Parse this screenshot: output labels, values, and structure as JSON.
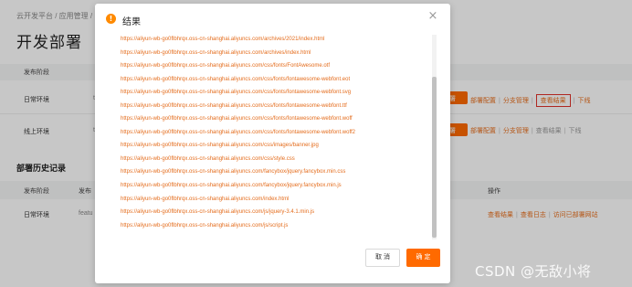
{
  "background": {
    "breadcrumb": "云开发平台 / 应用管理 /",
    "page_title": "开发部署",
    "deploy_header": "发布阶段",
    "rows": [
      {
        "label": "日常环境",
        "frag": "t"
      },
      {
        "label": "线上环境",
        "frag": "t"
      }
    ],
    "deploy_button": "署",
    "actions": {
      "config": "部署配置",
      "branch": "分支管理",
      "view_result": "查看结果",
      "offline": "下线"
    },
    "history_title": "部署历史记录",
    "history_headers": {
      "stage": "发布阶段",
      "version": "发布",
      "operation": "操作"
    },
    "history_row": {
      "stage": "日常环境",
      "version": "featu",
      "view_result": "查看结果",
      "view_log": "查看日志",
      "visit_site": "访问已部署网站"
    }
  },
  "modal": {
    "title": "结果",
    "links": [
      "https://aliyun-wb-go0flbhrqx.oss-cn-shanghai.aliyuncs.com/archives/2021/index.html",
      "https://aliyun-wb-go0flbhrqx.oss-cn-shanghai.aliyuncs.com/archives/index.html",
      "https://aliyun-wb-go0flbhrqx.oss-cn-shanghai.aliyuncs.com/css/fonts/FontAwesome.otf",
      "https://aliyun-wb-go0flbhrqx.oss-cn-shanghai.aliyuncs.com/css/fonts/fontawesome-webfont.eot",
      "https://aliyun-wb-go0flbhrqx.oss-cn-shanghai.aliyuncs.com/css/fonts/fontawesome-webfont.svg",
      "https://aliyun-wb-go0flbhrqx.oss-cn-shanghai.aliyuncs.com/css/fonts/fontawesome-webfont.ttf",
      "https://aliyun-wb-go0flbhrqx.oss-cn-shanghai.aliyuncs.com/css/fonts/fontawesome-webfont.woff",
      "https://aliyun-wb-go0flbhrqx.oss-cn-shanghai.aliyuncs.com/css/fonts/fontawesome-webfont.woff2",
      "https://aliyun-wb-go0flbhrqx.oss-cn-shanghai.aliyuncs.com/css/images/banner.jpg",
      "https://aliyun-wb-go0flbhrqx.oss-cn-shanghai.aliyuncs.com/css/style.css",
      "https://aliyun-wb-go0flbhrqx.oss-cn-shanghai.aliyuncs.com/fancybox/jquery.fancybox.min.css",
      "https://aliyun-wb-go0flbhrqx.oss-cn-shanghai.aliyuncs.com/fancybox/jquery.fancybox.min.js",
      "https://aliyun-wb-go0flbhrqx.oss-cn-shanghai.aliyuncs.com/index.html",
      "https://aliyun-wb-go0flbhrqx.oss-cn-shanghai.aliyuncs.com/js/jquery-3.4.1.min.js",
      "https://aliyun-wb-go0flbhrqx.oss-cn-shanghai.aliyuncs.com/js/script.js"
    ],
    "cancel_label": "取 消",
    "ok_label": "确 定",
    "icon": "info-icon",
    "accent_color": "#ff6a00"
  },
  "watermark": "CSDN @无敌小将"
}
